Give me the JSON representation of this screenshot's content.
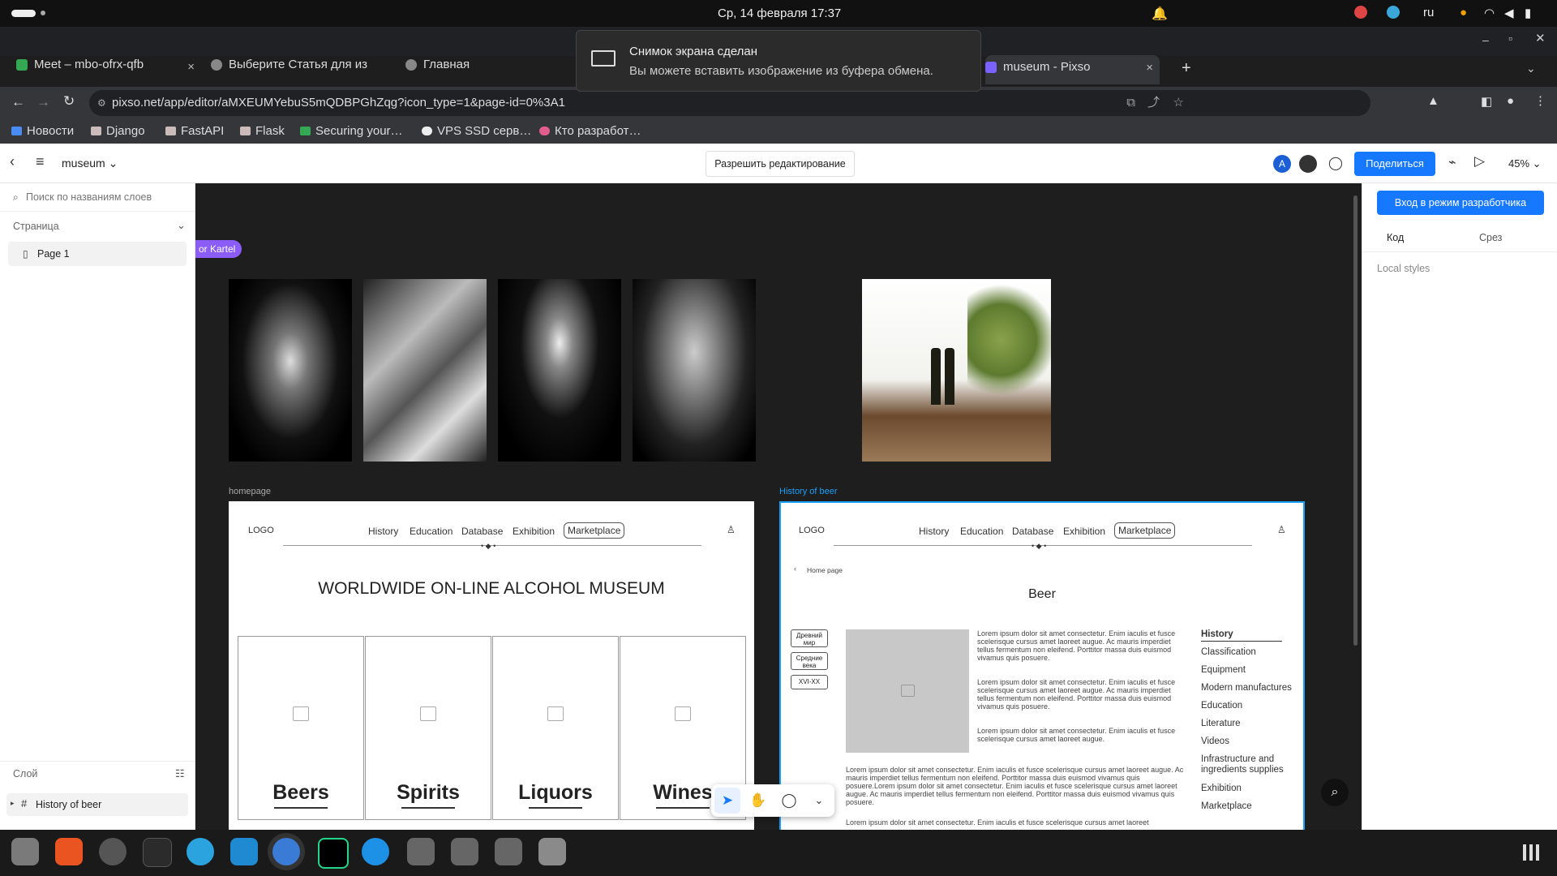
{
  "os": {
    "clock": "Ср, 14 февраля  17:37",
    "lang": "ru"
  },
  "browser": {
    "tabs": [
      {
        "title": "Meet – mbo-ofrx-qfb",
        "close": "×"
      },
      {
        "title": "Выберите Статья для из",
        "close": "×"
      },
      {
        "title": "Главная",
        "close": "×"
      },
      {
        "title": "museum - Pixso",
        "close": "×"
      }
    ],
    "new_tab": "+",
    "url": "pixso.net/app/editor/aMXEUMYebuS5mQDBPGhZqg?icon_type=1&page-id=0%3A1",
    "bookmarks": [
      "Новости",
      "Django",
      "FastAPI",
      "Flask",
      "Securing your…",
      "VPS SSD серв…",
      "Кто разработ…"
    ]
  },
  "toast": {
    "title": "Снимок экрана сделан",
    "body": "Вы можете вставить изображение из буфера обмена."
  },
  "app": {
    "file_name": "museum",
    "allow_edit": "Разрешить редактирование",
    "avatar_letter": "A",
    "share": "Поделиться",
    "zoom": "45%",
    "layer_search_placeholder": "Поиск по названиям слоев",
    "pages_label": "Страница",
    "page_item": "Page 1",
    "layers_label": "Слой",
    "layer_item": "History of beer",
    "dev_mode": "Вход в режим разработчика",
    "tab_code": "Код",
    "tab_slice": "Срез",
    "local_styles": "Local styles",
    "cursor_tag": "or Kartel"
  },
  "frames": {
    "homepage": {
      "label": "homepage",
      "logo": "LOGO",
      "nav": [
        "History",
        "Education",
        "Database",
        "Exhibition",
        "Marketplace"
      ],
      "title": "WORLDWIDE ON-LINE ALCOHOL MUSEUM",
      "cards": [
        "Beers",
        "Spirits",
        "Liquors",
        "Wines"
      ]
    },
    "beer": {
      "label": "History of beer",
      "logo": "LOGO",
      "nav": [
        "History",
        "Education",
        "Database",
        "Exhibition",
        "Marketplace"
      ],
      "breadcrumb": "Home page",
      "title": "Beer",
      "eras": [
        "Древний мир",
        "Средние века",
        "XVI-XX"
      ],
      "lorem_a": "Lorem ipsum dolor sit amet consectetur. Enim iaculis et fusce scelerisque cursus amet laoreet augue. Ac mauris imperdiet tellus fermentum non eleifend. Porttitor massa duis euismod vivamus quis posuere.",
      "lorem_b": "Lorem ipsum dolor sit amet consectetur. Enim iaculis et fusce scelerisque cursus amet laoreet augue.",
      "lorem_wide": "Lorem ipsum dolor sit amet consectetur. Enim iaculis et fusce scelerisque cursus amet laoreet augue. Ac mauris imperdiet tellus fermentum non eleifend. Porttitor massa duis euismod vivamus quis posuere.Lorem ipsum dolor sit amet consectetur. Enim iaculis et fusce scelerisque cursus amet laoreet augue. Ac mauris imperdiet tellus fermentum non eleifend. Porttitor massa duis euismod vivamus quis posuere.",
      "lorem_cut": "Lorem ipsum dolor sit amet consectetur. Enim iaculis et fusce scelerisque cursus amet laoreet",
      "side_menu": [
        "History",
        "Classification",
        "Equipment",
        "Modern manufactures",
        "Education",
        "Literature",
        "Videos",
        "Infrastructure and ingredients supplies",
        "Exhibition",
        "Marketplace"
      ]
    }
  },
  "colors": {
    "accent": "#1677ff",
    "cursor_tag": "#8b5cf6",
    "selection": "#18a0fb"
  }
}
